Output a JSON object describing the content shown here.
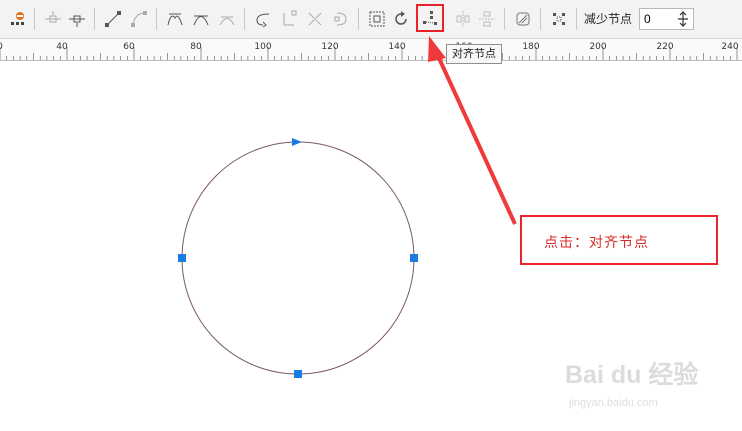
{
  "toolbar": {
    "reduce_nodes_label": "减少节点",
    "reduce_nodes_value": "0",
    "buttons": [
      {
        "name": "select-all-nodes",
        "icon": "select-all-nodes-icon"
      },
      {
        "name": "add-node",
        "icon": "add-node-icon"
      },
      {
        "name": "delete-node",
        "icon": "delete-node-icon"
      },
      {
        "name": "to-line",
        "icon": "to-line-icon"
      },
      {
        "name": "to-curve",
        "icon": "to-curve-icon"
      },
      {
        "name": "cusp-node",
        "icon": "cusp-node-icon"
      },
      {
        "name": "smooth-node",
        "icon": "smooth-node-icon"
      },
      {
        "name": "symmetric-node",
        "icon": "symmetric-node-icon"
      },
      {
        "name": "reverse-direction",
        "icon": "reverse-direction-icon"
      },
      {
        "name": "extend-curve",
        "icon": "extend-curve-icon"
      },
      {
        "name": "break-curve",
        "icon": "break-curve-icon"
      },
      {
        "name": "join-nodes",
        "icon": "join-nodes-icon"
      },
      {
        "name": "stretch-scale-nodes",
        "icon": "stretch-scale-nodes-icon"
      },
      {
        "name": "rotate-skew-nodes",
        "icon": "rotate-skew-nodes-icon"
      },
      {
        "name": "align-nodes",
        "icon": "align-nodes-icon"
      },
      {
        "name": "mirror-horizontal",
        "icon": "mirror-horizontal-icon"
      },
      {
        "name": "mirror-vertical",
        "icon": "mirror-vertical-icon"
      },
      {
        "name": "elastic-mode",
        "icon": "elastic-mode-icon"
      },
      {
        "name": "select-all-nodes-alt",
        "icon": "select-all-nodes-alt-icon"
      }
    ]
  },
  "ruler": {
    "labels": [
      "0",
      "40",
      "60",
      "80",
      "100",
      "120",
      "140",
      "160",
      "180",
      "200",
      "220",
      "240"
    ]
  },
  "tooltip": {
    "text": "对齐节点"
  },
  "callout": {
    "text": "点击：对齐节点"
  },
  "watermark": {
    "logo": "Bai du 经验",
    "url": "jingyan.baidu.com"
  },
  "colors": {
    "highlight": "#e8242a",
    "node": "#1a7be0",
    "circle_stroke": "#7a5a63"
  }
}
